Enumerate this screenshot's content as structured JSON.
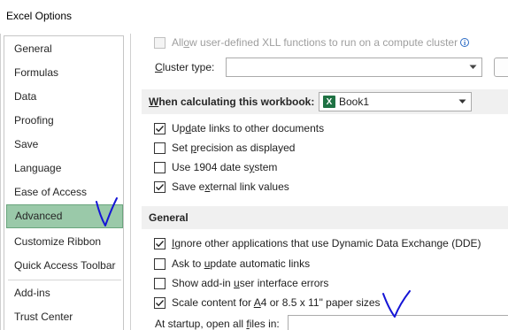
{
  "window": {
    "title": "Excel Options"
  },
  "sidebar": {
    "items": [
      {
        "label": "General",
        "selected": false
      },
      {
        "label": "Formulas",
        "selected": false
      },
      {
        "label": "Data",
        "selected": false
      },
      {
        "label": "Proofing",
        "selected": false
      },
      {
        "label": "Save",
        "selected": false
      },
      {
        "label": "Language",
        "selected": false
      },
      {
        "label": "Ease of Access",
        "selected": false
      },
      {
        "label": "Advanced",
        "selected": true
      },
      {
        "label": "Customize Ribbon",
        "selected": false
      },
      {
        "label": "Quick Access Toolbar",
        "selected": false
      },
      {
        "label": "Add-ins",
        "selected": false
      },
      {
        "label": "Trust Center",
        "selected": false
      }
    ]
  },
  "content": {
    "xll_option": {
      "pre": "All",
      "ul": "o",
      "post": "w user-defined XLL functions to run on a compute cluster",
      "checked": false,
      "disabled": true
    },
    "cluster_type": {
      "ul": "C",
      "post": "luster type:",
      "value": ""
    },
    "calc_section": {
      "title_ul": "W",
      "title_post": "hen calculating this workbook:",
      "workbook_value": "Book1",
      "excel_icon_letter": "X",
      "options": [
        {
          "pre": "Up",
          "ul": "d",
          "post": "ate links to other documents",
          "checked": true
        },
        {
          "pre": "Set ",
          "ul": "p",
          "post": "recision as displayed",
          "checked": false
        },
        {
          "pre": "Use 1904 date s",
          "ul": "y",
          "post": "stem",
          "checked": false
        },
        {
          "pre": "Save e",
          "ul": "x",
          "post": "ternal link values",
          "checked": true
        }
      ]
    },
    "general_section": {
      "title": "General",
      "options": [
        {
          "pre": "",
          "ul": "I",
          "post": "gnore other applications that use Dynamic Data Exchange (DDE)",
          "checked": true
        },
        {
          "pre": "Ask to ",
          "ul": "u",
          "post": "pdate automatic links",
          "checked": false
        },
        {
          "pre": "Show add-in ",
          "ul": "u",
          "post": "ser interface errors",
          "checked": false
        },
        {
          "pre": "Scale content for ",
          "ul": "A",
          "post": "4 or 8.5 x 11\" paper sizes",
          "checked": true
        }
      ],
      "startup_label": {
        "pre": "At startup, open all ",
        "ul": "f",
        "post": "iles in:"
      },
      "startup_value": ""
    }
  }
}
